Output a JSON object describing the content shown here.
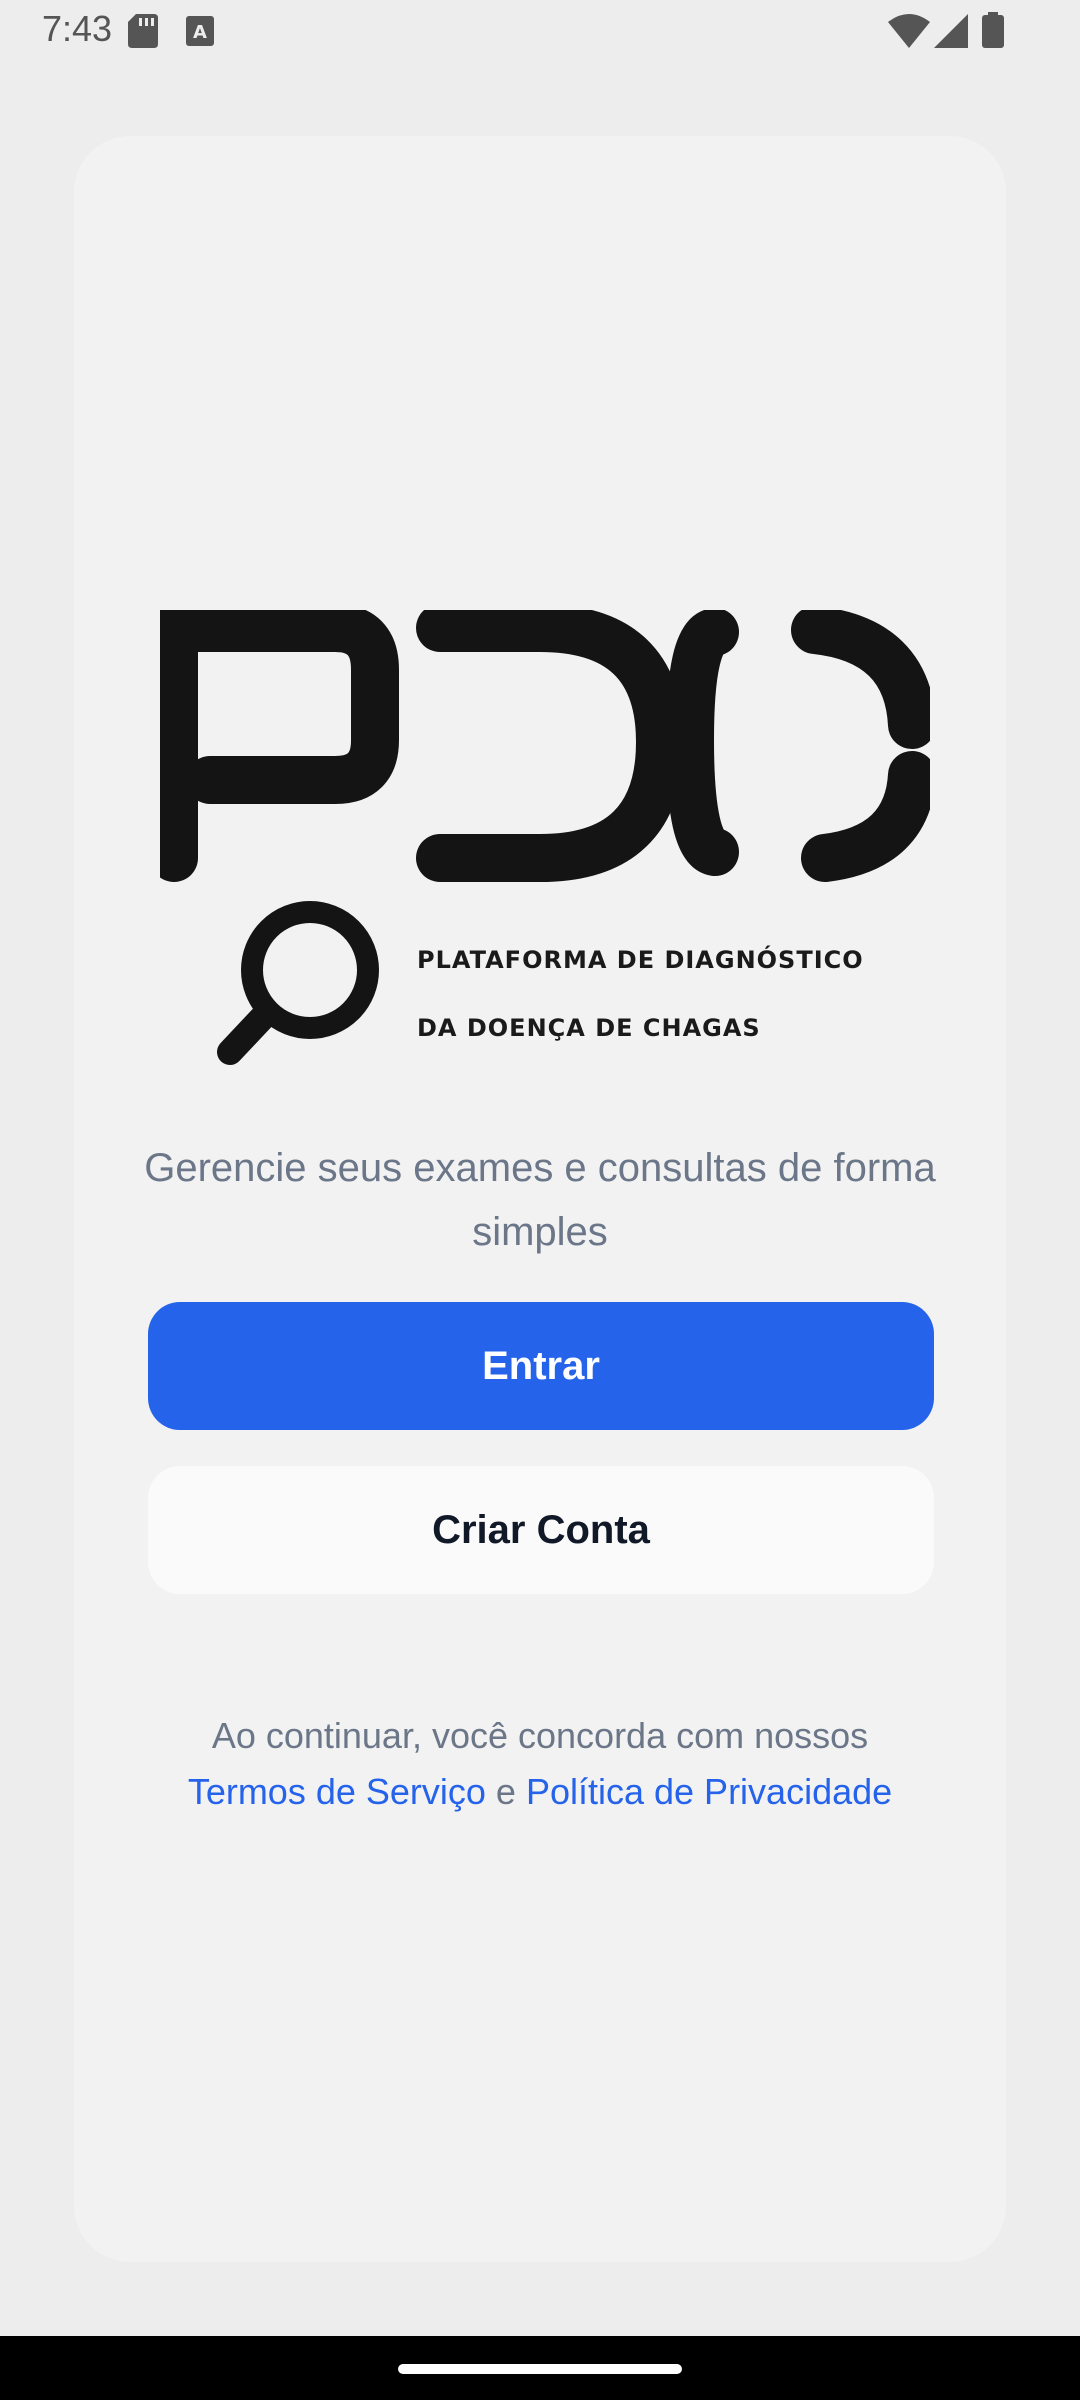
{
  "status_bar": {
    "time": "7:43",
    "icons": [
      "sd-card-icon",
      "keyboard-a-icon",
      "wifi-icon",
      "signal-icon",
      "battery-icon"
    ]
  },
  "logo": {
    "letters": "PDC",
    "line1": "PLATAFORMA DE DIAGNÓSTICO",
    "line2": "DA DOENÇA DE CHAGAS",
    "icon": "magnifier-icon"
  },
  "subtitle": "Gerencie seus exames e consultas de forma simples",
  "buttons": {
    "login": "Entrar",
    "signup": "Criar Conta"
  },
  "legal": {
    "prefix": "Ao continuar, você concorda com nossos",
    "terms": "Termos de Serviço",
    "conjunction": " e ",
    "privacy": "Política de Privacidade"
  },
  "colors": {
    "primary": "#2563eb",
    "background": "#ededed",
    "card": "#f2f2f2",
    "text_muted": "#6b7688"
  }
}
